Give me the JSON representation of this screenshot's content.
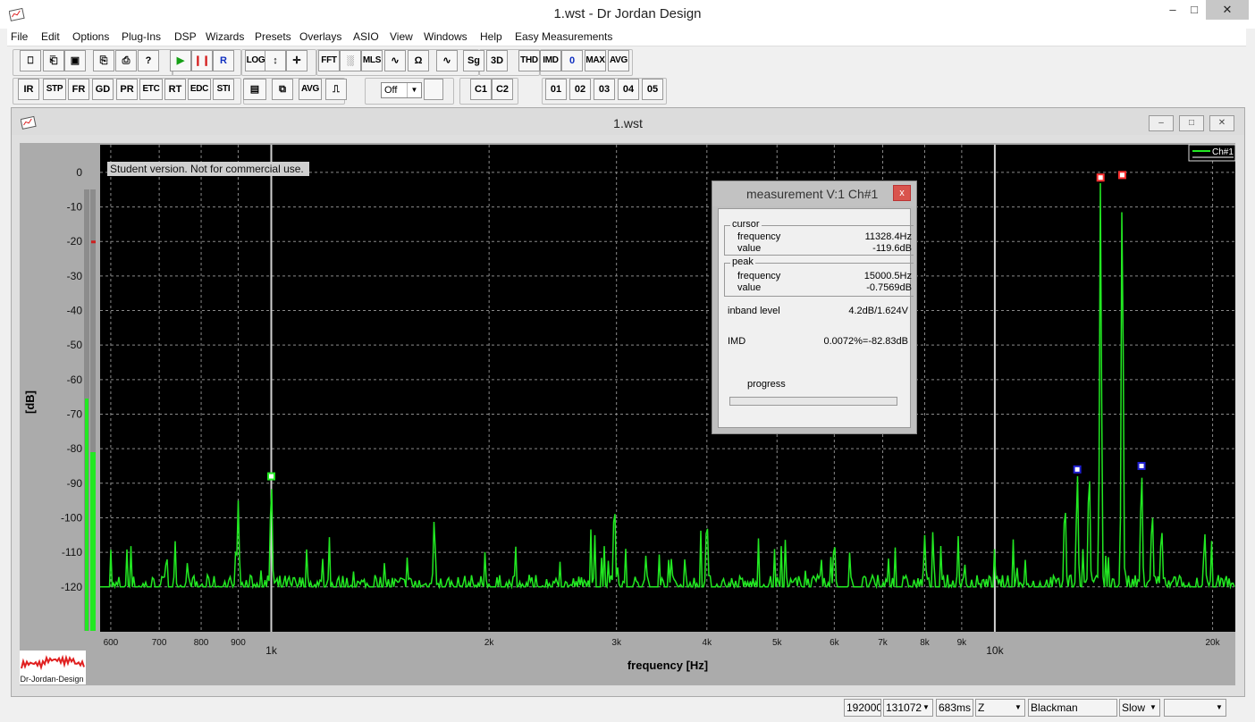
{
  "window": {
    "title": "1.wst - Dr Jordan Design",
    "min": "–",
    "max": "□",
    "close": "✕"
  },
  "menu": [
    "File",
    "Edit",
    "Options",
    "Plug-Ins",
    "DSP",
    "Wizards",
    "Presets",
    "Overlays",
    "ASIO",
    "View",
    "Windows",
    "Help",
    "Easy Measurements"
  ],
  "toolbar1": {
    "buttons": [
      "⎕",
      "⎗",
      "▣",
      "⎘",
      "⎙",
      "?",
      "▶",
      "❙❙",
      "R",
      "LOG",
      "↕",
      "✛",
      "FFT",
      "░",
      "MLS",
      "∿",
      "Ω",
      "∿",
      "Sg",
      "3D",
      "THD",
      "IMD",
      "0",
      "MAX",
      "AVG"
    ]
  },
  "toolbar2": {
    "buttons": [
      "IR",
      "STP",
      "FR",
      "GD",
      "PR",
      "ETC",
      "RT",
      "EDC",
      "STI",
      "▤",
      "⧉",
      "AVG",
      "⎍"
    ],
    "combo_value": "Off",
    "channels": [
      "C1",
      "C2"
    ],
    "overlays": [
      "01",
      "02",
      "03",
      "04",
      "05"
    ]
  },
  "child": {
    "title": "1.wst",
    "min": "–",
    "max": "□",
    "close": "✕"
  },
  "plot": {
    "watermark": "Student version. Not for commercial use.",
    "ylabel": "[dB]",
    "xlabel": "frequency [Hz]",
    "legend": "Ch#1",
    "logo_text": "Dr-Jordan-Design",
    "colors": {
      "trace": "#22e822",
      "background": "#000000",
      "grid": "#8a8a8a",
      "cursor_marker": "#ff3030",
      "peak_marker": "#1e1ed0"
    }
  },
  "chart_data": {
    "type": "line",
    "x_scale": "log",
    "xlim": [
      580,
      21500
    ],
    "ylim": [
      -133,
      8
    ],
    "yticks": [
      0,
      -10,
      -20,
      -30,
      -40,
      -50,
      -60,
      -70,
      -80,
      -90,
      -100,
      -110,
      -120
    ],
    "xticks": [
      {
        "v": 600,
        "label": "600"
      },
      {
        "v": 700,
        "label": "700"
      },
      {
        "v": 800,
        "label": "800"
      },
      {
        "v": 900,
        "label": "900"
      },
      {
        "v": 1000,
        "label": "1k"
      },
      {
        "v": 2000,
        "label": "2k"
      },
      {
        "v": 3000,
        "label": "3k"
      },
      {
        "v": 4000,
        "label": "4k"
      },
      {
        "v": 5000,
        "label": "5k"
      },
      {
        "v": 6000,
        "label": "6k"
      },
      {
        "v": 7000,
        "label": "7k"
      },
      {
        "v": 8000,
        "label": "8k"
      },
      {
        "v": 9000,
        "label": "9k"
      },
      {
        "v": 10000,
        "label": "10k"
      },
      {
        "v": 20000,
        "label": "20k"
      }
    ],
    "grid": true,
    "legend": "top-right",
    "noise_floor_db": -120,
    "series": [
      {
        "name": "Ch#1",
        "peaks": [
          {
            "f": 900,
            "db": -95
          },
          {
            "f": 1000,
            "db": -88
          },
          {
            "f": 1680,
            "db": -100
          },
          {
            "f": 2980,
            "db": -94
          },
          {
            "f": 4000,
            "db": -99
          },
          {
            "f": 6000,
            "db": -106
          },
          {
            "f": 8000,
            "db": -105
          },
          {
            "f": 12500,
            "db": -94
          },
          {
            "f": 13000,
            "db": -86
          },
          {
            "f": 13500,
            "db": -84
          },
          {
            "f": 14000,
            "db": -1
          },
          {
            "f": 15000,
            "db": -0.76
          },
          {
            "f": 15950,
            "db": -85
          },
          {
            "f": 16500,
            "db": -97
          },
          {
            "f": 17000,
            "db": -102
          },
          {
            "f": 19500,
            "db": -104
          }
        ]
      }
    ],
    "markers": [
      {
        "f": 1000,
        "db": -88,
        "kind": "cursor"
      },
      {
        "f": 13000,
        "db": -86,
        "kind": "peak-blue"
      },
      {
        "f": 14000,
        "db": -1.5,
        "kind": "peak-red"
      },
      {
        "f": 15000,
        "db": -0.76,
        "kind": "peak-red"
      },
      {
        "f": 15950,
        "db": -85,
        "kind": "peak-blue"
      }
    ],
    "vlines": [
      1000,
      10000
    ],
    "level_meter_db": [
      -81,
      -20
    ]
  },
  "measurement": {
    "title": "measurement V:1 Ch#1",
    "close": "x",
    "cursor_label": "cursor",
    "peak_label": "peak",
    "cursor_frequency_label": "frequency",
    "cursor_frequency": "11328.4Hz",
    "cursor_value_label": "value",
    "cursor_value": "-119.6dB",
    "peak_frequency_label": "frequency",
    "peak_frequency": "15000.5Hz",
    "peak_value_label": "value",
    "peak_value": "-0.7569dB",
    "inband_label": "inband level",
    "inband_value": "4.2dB/1.624V",
    "imd_label": "IMD",
    "imd_value": "0.0072%=-82.83dB",
    "progress_label": "progress",
    "progress": 0.0
  },
  "status": {
    "rate": "192000",
    "fft_size": "131072",
    "time": "683ms",
    "weighting": "Z",
    "window": "Blackman",
    "speed": "Slow",
    "extra": ""
  }
}
